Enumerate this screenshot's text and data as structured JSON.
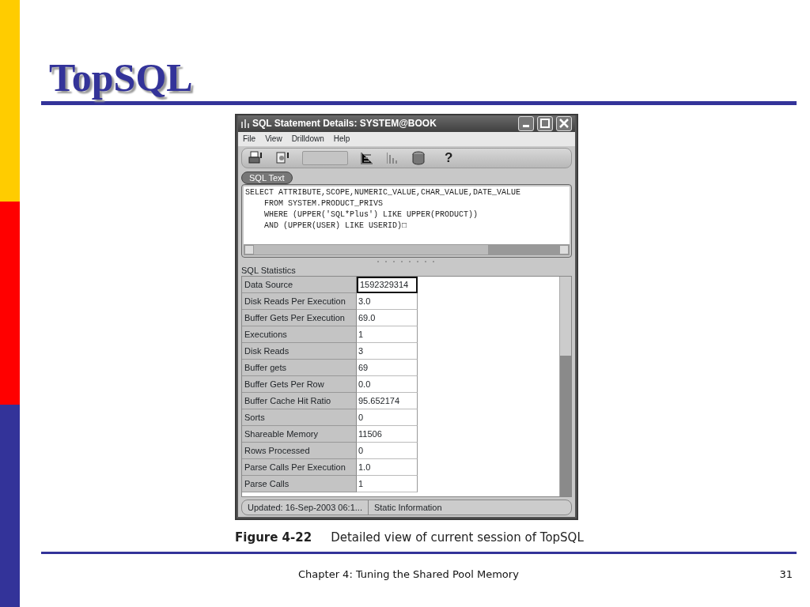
{
  "slide": {
    "title": "TopSQL",
    "window": {
      "title": "SQL Statement Details: SYSTEM@BOOK",
      "menu": [
        "File",
        "View",
        "Drilldown",
        "Help"
      ],
      "toolbar": {
        "help_label": "?"
      },
      "sql_text": {
        "label": "SQL Text",
        "lines": [
          "SELECT ATTRIBUTE,SCOPE,NUMERIC_VALUE,CHAR_VALUE,DATE_VALUE",
          "    FROM SYSTEM.PRODUCT_PRIVS",
          "    WHERE (UPPER('SQL*Plus') LIKE UPPER(PRODUCT))",
          "    AND (UPPER(USER) LIKE USERID)□"
        ]
      },
      "statistics": {
        "label": "SQL Statistics",
        "rows": [
          {
            "name": "Data Source",
            "value": "1592329314",
            "selected": true
          },
          {
            "name": "Disk Reads Per Execution",
            "value": "3.0",
            "selected": false
          },
          {
            "name": "Buffer Gets Per Execution",
            "value": "69.0",
            "selected": false
          },
          {
            "name": "Executions",
            "value": "1",
            "selected": false
          },
          {
            "name": "Disk Reads",
            "value": "3",
            "selected": false
          },
          {
            "name": "Buffer gets",
            "value": "69",
            "selected": false
          },
          {
            "name": "Buffer Gets Per Row",
            "value": "0.0",
            "selected": false
          },
          {
            "name": "Buffer Cache Hit Ratio",
            "value": "95.652174",
            "selected": false
          },
          {
            "name": "Sorts",
            "value": "0",
            "selected": false
          },
          {
            "name": "Shareable Memory",
            "value": "11506",
            "selected": false
          },
          {
            "name": "Rows Processed",
            "value": "0",
            "selected": false
          },
          {
            "name": "Parse Calls Per Execution",
            "value": "1.0",
            "selected": false
          },
          {
            "name": "Parse Calls",
            "value": "1",
            "selected": false
          }
        ]
      },
      "status_bar": [
        "Updated: 16-Sep-2003 06:1...",
        "Static Information"
      ]
    },
    "caption": {
      "label": "Figure 4-22",
      "text": "Detailed view of current session of TopSQL"
    },
    "footer": "Chapter 4: Tuning the Shared Pool Memory",
    "page_number": "31"
  }
}
